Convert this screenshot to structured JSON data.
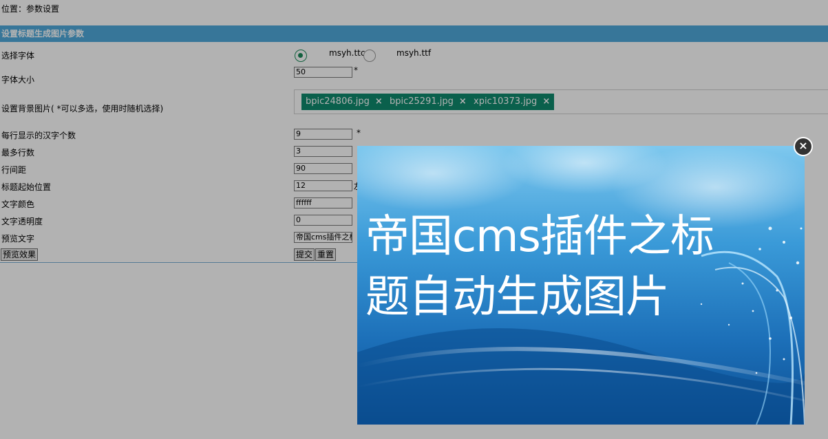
{
  "breadcrumb": {
    "text": "位置：参数设置"
  },
  "section": {
    "title": "设置标题生成图片参数"
  },
  "form": {
    "font": {
      "label": "选择字体",
      "options": [
        "msyh.ttc",
        "msyh.ttf"
      ],
      "selected": "msyh.ttc"
    },
    "font_size": {
      "label": "字体大小",
      "value": "50",
      "required_mark": "*"
    },
    "background": {
      "label": "设置背景图片( *可以多选，使用时随机选择)",
      "tags": [
        "bpic24806.jpg",
        "bpic25291.jpg",
        "xpic10373.jpg"
      ],
      "tag_remove_glyph": "×"
    },
    "chars_per_line": {
      "label": "每行显示的汉字个数",
      "value": "9",
      "required_mark": "*"
    },
    "max_lines": {
      "label": "最多行数",
      "value": "3"
    },
    "line_spacing": {
      "label": "行间距",
      "value": "90"
    },
    "title_start": {
      "label": "标题起始位置",
      "value": "12",
      "trailing_text": "左"
    },
    "text_color": {
      "label": "文字颜色",
      "value": "ffffff"
    },
    "text_opacity": {
      "label": "文字透明度",
      "value": "0"
    },
    "preview_text": {
      "label": "预览文字",
      "value": "帝国cms插件之标"
    }
  },
  "buttons": {
    "preview": "预览效果",
    "submit": "提交",
    "reset": "重置"
  },
  "modal": {
    "preview_text": "帝国cms插件之标题自动生成图片",
    "close_glyph": "×"
  },
  "colors": {
    "section_header": "#4faadc",
    "tag": "#0f8a6e",
    "radio_checked": "#1b8a5a"
  }
}
